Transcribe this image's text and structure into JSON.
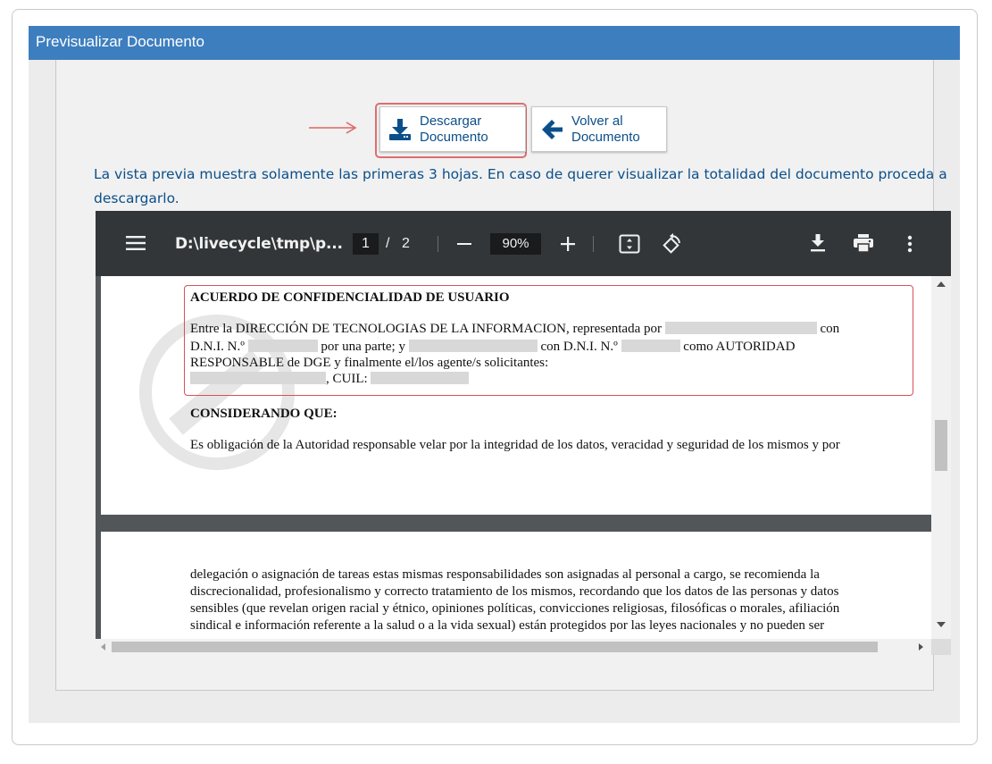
{
  "panel": {
    "title": "Previsualizar Documento"
  },
  "buttons": {
    "download": {
      "line1": "Descargar",
      "line2": "Documento"
    },
    "back": {
      "line1": "Volver al",
      "line2": "Documento"
    }
  },
  "notice": "La vista previa muestra solamente las primeras 3 hojas. En caso de querer visualizar la totalidad del documento proceda a descargarlo.",
  "viewer": {
    "title": "D:\\livecycle\\tmp\\p...",
    "current_page": "1",
    "page_separator": "/",
    "total_pages": "2",
    "zoom": "90%",
    "icons": {
      "menu": "menu-icon",
      "zoom_out": "minus-icon",
      "zoom_in": "plus-icon",
      "fit": "fit-page-icon",
      "rotate": "rotate-icon",
      "download": "download-icon",
      "print": "print-icon",
      "more": "more-vert-icon"
    }
  },
  "document": {
    "page1": {
      "heading": "ACUERDO DE CONFIDENCIALIDAD DE USUARIO",
      "p1_line1_a": "Entre la DIRECCIÓN DE TECNOLOGIAS DE LA INFORMACION, representada por",
      "p1_line1_b": "con",
      "p1_line2_a": "D.N.I. N.º",
      "p1_line2_b": "por una parte; y",
      "p1_line2_c": "con D.N.I. N.º",
      "p1_line2_d": "como AUTORIDAD",
      "p1_line3": "RESPONSABLE de DGE y finalmente el/los agente/s solicitantes:",
      "p1_line4": ", CUIL:",
      "heading2": "CONSIDERANDO QUE:",
      "p2": "Es obligación de la Autoridad responsable velar por la integridad de los datos, veracidad y seguridad de los mismos y por"
    },
    "page2": {
      "l1": "delegación o asignación de tareas estas mismas responsabilidades son asignadas al personal a cargo, se recomienda la",
      "l2": "discrecionalidad, profesionalismo y correcto tratamiento de los mismos, recordando que los datos de las personas y datos",
      "l3": "sensibles (que revelan origen racial y étnico, opiniones políticas, convicciones religiosas, filosóficas o morales, afiliación",
      "l4": "sindical e información referente a la salud o a la vida sexual) están protegidos por las leyes nacionales y no pueden ser"
    }
  },
  "colors": {
    "header_blue": "#3d7ebf",
    "text_blue": "#0b4f8a",
    "highlight_red": "#dd6e6e",
    "toolbar_dark": "#323639"
  }
}
